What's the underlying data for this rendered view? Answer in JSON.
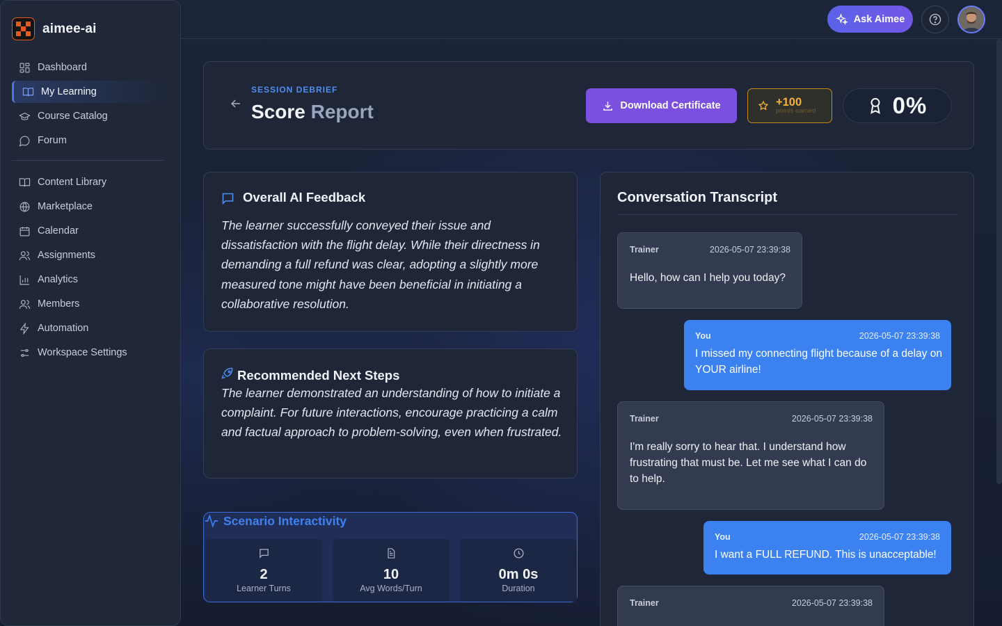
{
  "brand": {
    "name": "aimee-ai"
  },
  "nav": {
    "primary": [
      {
        "label": "Dashboard",
        "icon": "dashboard-icon"
      },
      {
        "label": "My Learning",
        "icon": "book-icon",
        "active": true
      },
      {
        "label": "Course Catalog",
        "icon": "graduation-cap-icon"
      },
      {
        "label": "Forum",
        "icon": "chat-bubble-icon"
      }
    ],
    "secondary": [
      {
        "label": "Content Library",
        "icon": "book-icon"
      },
      {
        "label": "Marketplace",
        "icon": "globe-icon"
      },
      {
        "label": "Calendar",
        "icon": "calendar-icon"
      },
      {
        "label": "Assignments",
        "icon": "users-icon"
      },
      {
        "label": "Analytics",
        "icon": "bar-chart-icon"
      },
      {
        "label": "Members",
        "icon": "users-icon"
      },
      {
        "label": "Automation",
        "icon": "lightning-icon"
      },
      {
        "label": "Workspace Settings",
        "icon": "sliders-icon"
      }
    ]
  },
  "topbar": {
    "ask_label": "Ask Aimee"
  },
  "header": {
    "eyebrow": "SESSION DEBRIEF",
    "title_main": "Score",
    "title_muted": "Report",
    "download_label": "Download Certificate",
    "points_value": "+100",
    "points_sub": "points earned",
    "score": "0%"
  },
  "feedback": {
    "title": "Overall AI Feedback",
    "body": "The learner successfully conveyed their issue and dissatisfaction with the flight delay. While their directness in demanding a full refund was clear, adopting a slightly more measured tone might have been beneficial in initiating a collaborative resolution."
  },
  "next_steps": {
    "title": "Recommended Next Steps",
    "body": "The learner demonstrated an understanding of how to initiate a complaint. For future interactions, encourage practicing a calm and factual approach to problem-solving, even when frustrated."
  },
  "interactivity": {
    "title": "Scenario Interactivity",
    "stats": [
      {
        "value": "2",
        "label": "Learner Turns",
        "icon": "chat-bubble-icon"
      },
      {
        "value": "10",
        "label": "Avg Words/Turn",
        "icon": "document-icon"
      },
      {
        "value": "0m 0s",
        "label": "Duration",
        "icon": "clock-icon"
      }
    ]
  },
  "transcript": {
    "title": "Conversation Transcript",
    "messages": [
      {
        "role": "Trainer",
        "time": "2026-05-07 23:39:38",
        "text": "Hello, how can I help you today?"
      },
      {
        "role": "You",
        "time": "2026-05-07 23:39:38",
        "text": "I missed my connecting flight because of a delay on YOUR airline!"
      },
      {
        "role": "Trainer",
        "time": "2026-05-07 23:39:38",
        "text": "I'm really sorry to hear that. I understand how frustrating that must be. Let me see what I can do to help."
      },
      {
        "role": "You",
        "time": "2026-05-07 23:39:38",
        "text": "I want a FULL REFUND. This is unacceptable!"
      },
      {
        "role": "Trainer",
        "time": "2026-05-07 23:39:38",
        "text": ""
      }
    ]
  },
  "colors": {
    "accent_purple": "#7b4fe0",
    "accent_blue": "#3b82f0",
    "points_gold": "#f3b23a"
  }
}
